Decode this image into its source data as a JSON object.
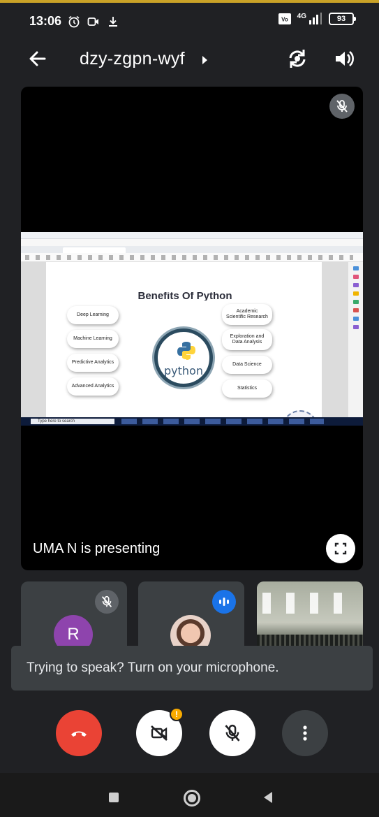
{
  "status_bar": {
    "time": "13:06",
    "network": "4G",
    "battery": "93"
  },
  "header": {
    "meeting_code": "dzy-zgpn-wyf"
  },
  "main_tile": {
    "presenting_text": "UMA N is presenting",
    "shared_screen": {
      "slide_title": "Benefits Of Python",
      "center_word": "python",
      "left_items": [
        "Deep Learning",
        "Machine Learning",
        "Predictive Analytics",
        "Advanced Analytics"
      ],
      "right_items": [
        "Academic Scientific Research",
        "Exploration and Data Analysis",
        "Data Science",
        "Statistics"
      ],
      "search_text": "Type here to search"
    }
  },
  "participants": [
    {
      "initial": "R",
      "muted": true
    },
    {
      "speaking": true
    },
    {
      "type": "room"
    }
  ],
  "toast": {
    "message": "Trying to speak? Turn on your microphone."
  },
  "controls": {
    "camera_badge": "!"
  },
  "colors": {
    "background": "#202124",
    "end_call": "#ea4335",
    "avatar_r": "#8e44ad",
    "speaking_blue": "#1a73e8",
    "badge": "#f9ab00"
  }
}
